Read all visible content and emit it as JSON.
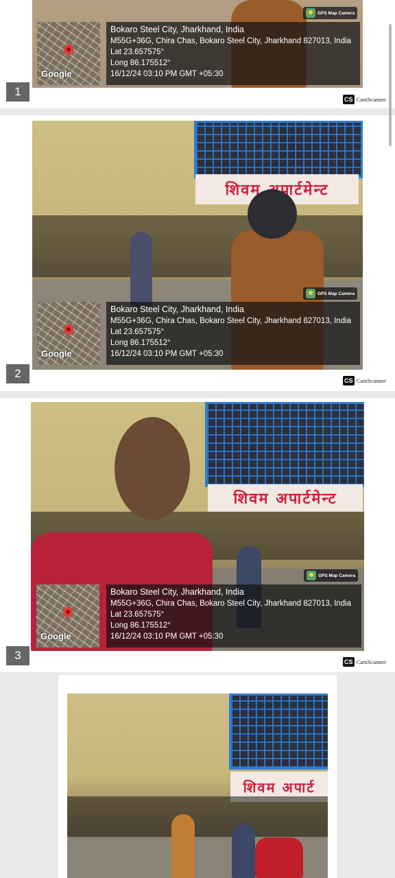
{
  "pages": [
    {
      "number": "1",
      "overlay": {
        "title": "Bokaro Steel City, Jharkhand, India",
        "address": "M55G+36G, Chira Chas, Bokaro Steel City, Jharkhand 827013, India",
        "lat": "Lat 23.657575°",
        "long": "Long 86.175512°",
        "datetime": "16/12/24 03:10 PM GMT +05:30"
      },
      "map_label": "Google",
      "badge": "GPS Map Camera",
      "cs_logo": "CS",
      "cs_text": "CamScanner"
    },
    {
      "number": "2",
      "overlay": {
        "title": "Bokaro Steel City, Jharkhand, India",
        "address": "M55G+36G, Chira Chas, Bokaro Steel City, Jharkhand 827013, India",
        "lat": "Lat 23.657575°",
        "long": "Long 86.175512°",
        "datetime": "16/12/24 03:10 PM GMT +05:30"
      },
      "map_label": "Google",
      "badge": "GPS Map Camera",
      "sign_text": "शिवम अपार्टमेन्ट",
      "cs_logo": "CS",
      "cs_text": "CamScanner"
    },
    {
      "number": "3",
      "overlay": {
        "title": "Bokaro Steel City, Jharkhand, India",
        "address": "M55G+36G, Chira Chas, Bokaro Steel City, Jharkhand 827013, India",
        "lat": "Lat 23.657575°",
        "long": "Long 86.175512°",
        "datetime": "16/12/24 03:10 PM GMT +05:30"
      },
      "map_label": "Google",
      "badge": "GPS Map Camera",
      "sign_text": "शिवम अपार्टमेन्ट",
      "cs_logo": "CS",
      "cs_text": "CamScanner"
    },
    {
      "sign_text": "शिवम अपार्ट"
    }
  ],
  "colors": {
    "accent_blue": "#2f7fd0",
    "sign_red": "#d21d3c",
    "page_bg": "#ffffff",
    "viewer_bg": "#e9e9e9"
  }
}
